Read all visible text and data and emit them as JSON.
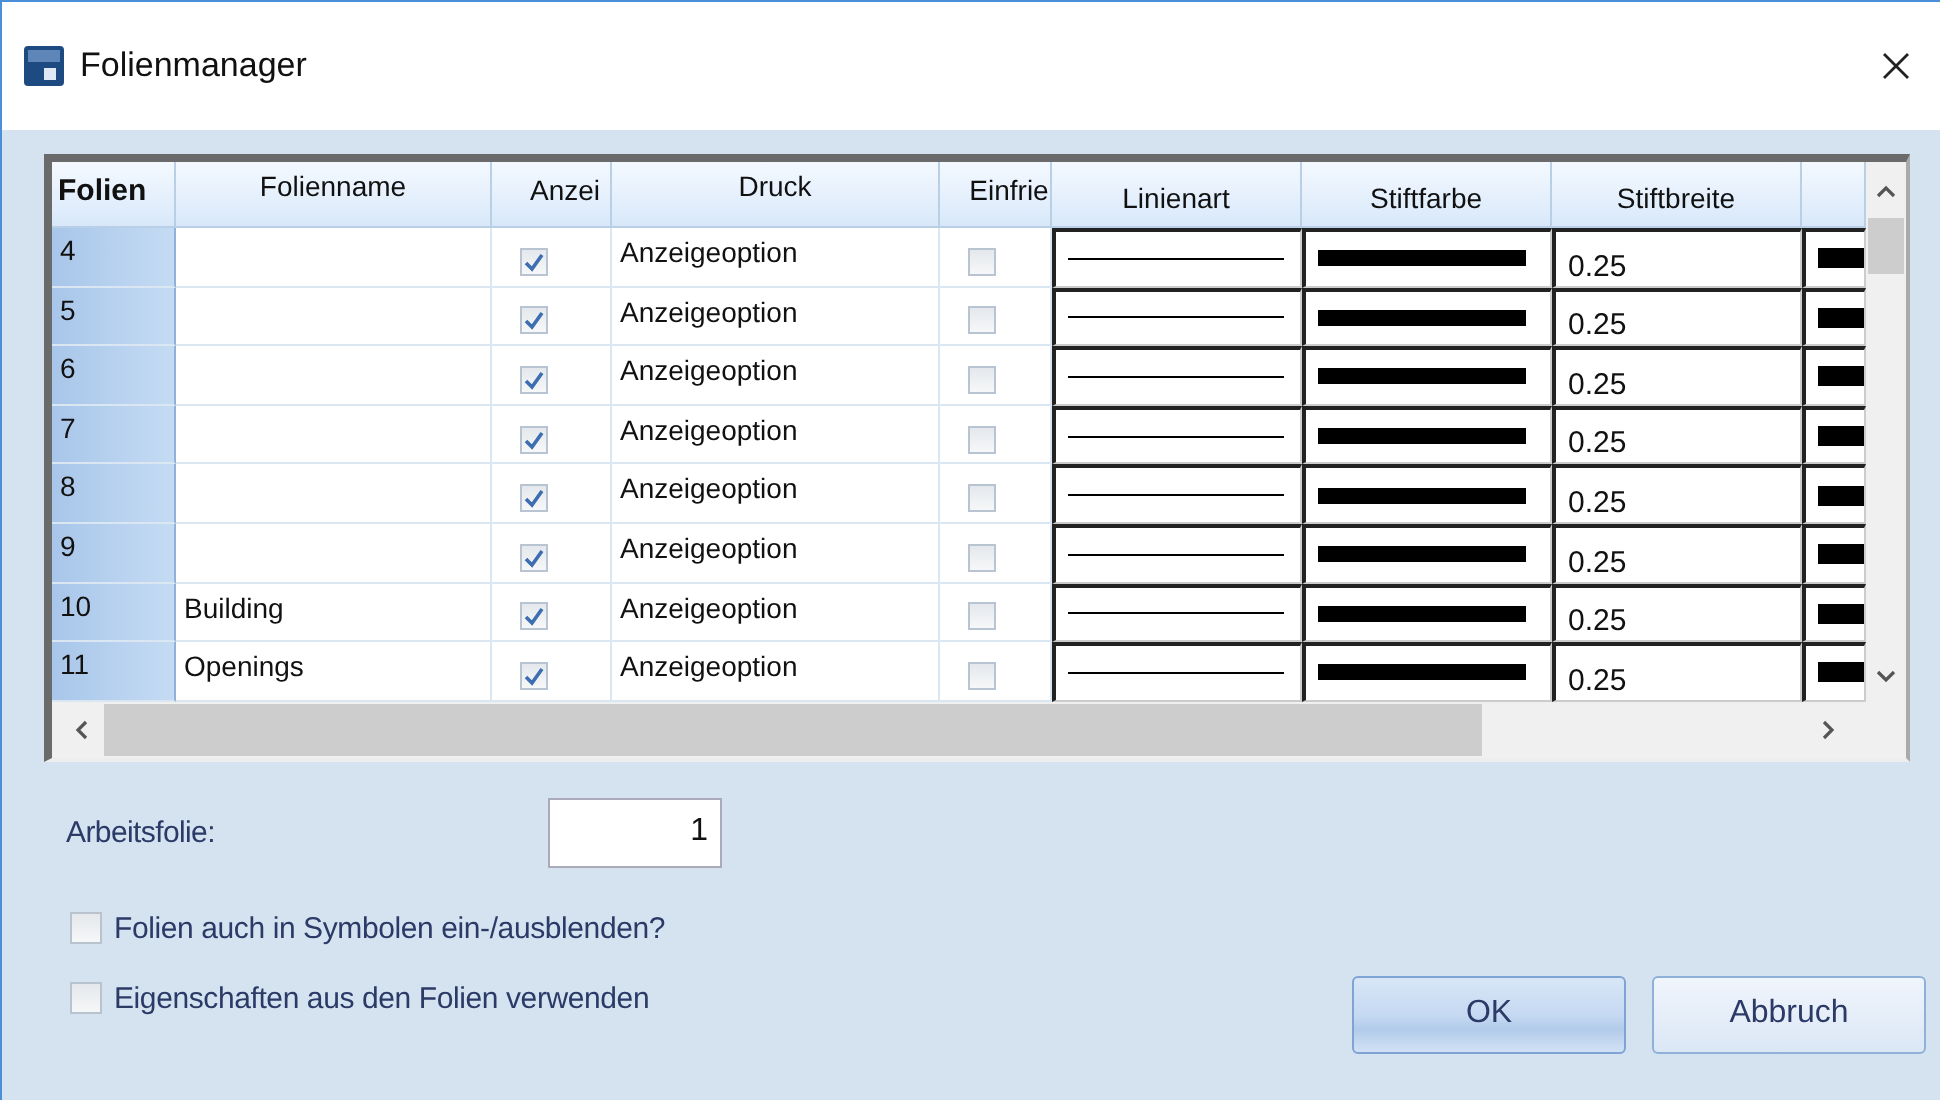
{
  "window": {
    "title": "Folienmanager"
  },
  "table": {
    "columns": [
      "Folien",
      "Folienname",
      "Anzei",
      "Druck",
      "Einfrie",
      "Linienart",
      "Stiftfarbe",
      "Stiftbreite"
    ],
    "rows": [
      {
        "folie": "4",
        "anzeige": true,
        "druck": "Anzeigeoption",
        "einfrieren": false,
        "stiftbreite": "0.25"
      },
      {
        "folie": "5",
        "anzeige": true,
        "druck": "Anzeigeoption",
        "einfrieren": false,
        "stiftbreite": "0.25"
      },
      {
        "folie": "6",
        "anzeige": true,
        "druck": "Anzeigeoption",
        "einfrieren": false,
        "stiftbreite": "0.25"
      },
      {
        "folie": "7",
        "anzeige": true,
        "druck": "Anzeigeoption",
        "einfrieren": false,
        "stiftbreite": "0.25"
      },
      {
        "folie": "8",
        "anzeige": true,
        "druck": "Anzeigeoption",
        "einfrieren": false,
        "stiftbreite": "0.25"
      },
      {
        "folie": "9",
        "anzeige": true,
        "druck": "Anzeigeoption",
        "einfrieren": false,
        "stiftbreite": "0.25"
      },
      {
        "folie": "10",
        "name": "Building",
        "anzeige": true,
        "druck": "Anzeigeoption",
        "einfrieren": false,
        "stiftbreite": "0.25"
      },
      {
        "folie": "11",
        "name": "Openings",
        "anzeige": true,
        "druck": "Anzeigeoption",
        "einfrieren": false,
        "stiftbreite": "0.25"
      }
    ]
  },
  "arbeitsfolie": {
    "label": "Arbeitsfolie:",
    "value": "1"
  },
  "options": [
    {
      "label": "Folien auch in Symbolen ein-/ausblenden?",
      "checked": false
    },
    {
      "label": "Eigenschaften aus den Folien verwenden",
      "checked": false
    }
  ],
  "buttons": [
    {
      "label": "OK",
      "default": true
    },
    {
      "label": "Abbruch",
      "default": false
    }
  ]
}
